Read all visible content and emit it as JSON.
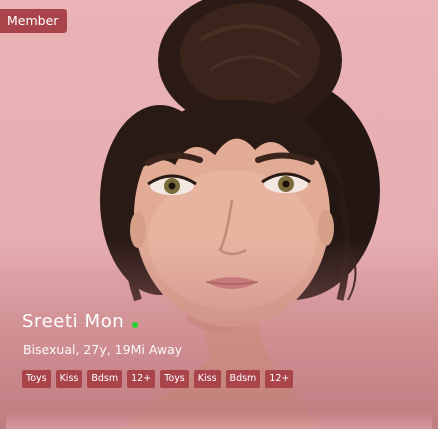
{
  "profile": {
    "badge": "Member",
    "name": "Sreeti Mon",
    "subtitle": "Bisexual, 27y, 19Mi Away",
    "tags": [
      "Toys",
      "Kiss",
      "Bdsm",
      "12+",
      "Toys",
      "Kiss",
      "Bdsm",
      "12+"
    ]
  },
  "colors": {
    "accent": "#a9444b",
    "online": "#24d234",
    "background": "#e9b0b2"
  }
}
